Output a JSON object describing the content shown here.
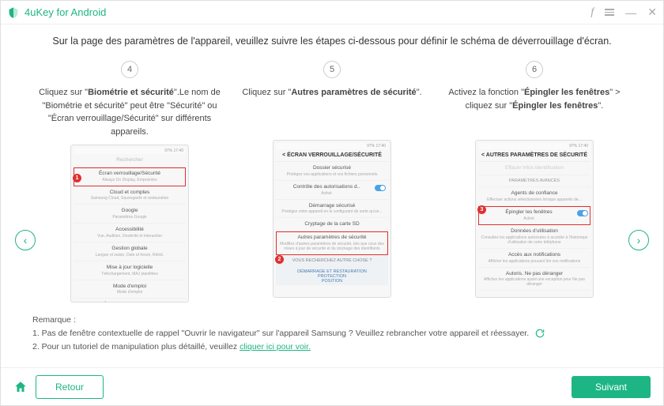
{
  "titlebar": {
    "appName": "4uKey for Android"
  },
  "instruction": "Sur la page des paramètres de l'appareil, veuillez suivre les étapes ci-dessous pour définir le schéma de déverrouillage d'écran.",
  "steps": [
    {
      "num": "4",
      "pre": "Cliquez sur \"",
      "bold": "Biométrie et sécurité",
      "post": "\".Le nom de \"Biométrie et sécurité\" peut être \"Sécurité\" ou \"Écran verrouillage/Sécurité\" sur différents appareils."
    },
    {
      "num": "5",
      "pre": "Cliquez sur \"",
      "bold": "Autres paramètres de sécurité",
      "post": "\"."
    },
    {
      "num": "6",
      "pre": "Activez la fonction \"",
      "bold": "Épingler les fenêtres",
      "mid": "\" > cliquez sur \"",
      "bold2": "Épingler les fenêtres",
      "post": "\"."
    }
  ],
  "phone1": {
    "search": "Rechercher",
    "hl": "Écran verrouillage/Sécurité",
    "hlSub": "Always On Display, Empreintes",
    "items": [
      {
        "t": "Cloud et comptes",
        "s": "Samsung Cloud, Sauvegarde et restauration"
      },
      {
        "t": "Google",
        "s": "Paramètres Google"
      },
      {
        "t": "Accessibilité",
        "s": "Vue, Audition, Dextérité et interaction"
      },
      {
        "t": "Gestion globale",
        "s": "Langue et saisie, Date et heure, Réinit."
      },
      {
        "t": "Mise à jour logicielle",
        "s": "Téléchargement, MAJ planifiées"
      },
      {
        "t": "Mode d'emploi",
        "s": "Mode d'emploi"
      },
      {
        "t": "À propos du téléphone",
        "s": ""
      }
    ]
  },
  "phone2": {
    "head": "ÉCRAN VERROUILLAGE/SÉCURITÉ",
    "items": [
      {
        "t": "Dossier sécurisé",
        "s": "Protégez vos applications et vos fichiers personnels"
      },
      {
        "t": "Contrôle des autorisations d..",
        "s": "Activé",
        "toggle": true
      },
      {
        "t": "Démarrage sécurisé",
        "s": "Protégez votre appareil en le configurant de sorte qu'un..."
      },
      {
        "t": "Cryptage de la carte SD",
        "s": ""
      }
    ],
    "hl": "Autres paramètres de sécurité",
    "hlSub": "Modifiez d'autres paramètres de sécurité, tels que ceux des mises à jour de sécurité et du stockage des identifiants",
    "footer": [
      "DÉMARRAGE ET RESTAURATION",
      "PROTECTION",
      "POSITION"
    ],
    "footerHead": "VOUS RECHERCHEZ AUTRE CHOSE ?"
  },
  "phone3": {
    "head": "AUTRES PARAMÈTRES DE SÉCURITÉ",
    "items": [
      {
        "t": "Effacer infos identification",
        "s": ""
      },
      {
        "t": "PARAMÈTRES AVANCÉS",
        "s": "",
        "section": true
      },
      {
        "t": "Agents de confiance",
        "s": "Effectuer actions sélectionnées lorsque appareils de..."
      }
    ],
    "hl": "Épingler les fenêtres",
    "hlSub": "Activé",
    "after": [
      {
        "t": "Données d'utilisation",
        "s": "Consultez les applications autorisées à accéder à l'historique d'utilisation de votre téléphone"
      },
      {
        "t": "Accès aux notifications",
        "s": "Afficher les applications pouvant lire vos notifications"
      },
      {
        "t": "Autoris. Ne pas déranger",
        "s": "Affichez les applications ayant une exception pour Ne pas déranger"
      }
    ]
  },
  "remarks": {
    "title": "Remarque :",
    "line1": "1. Pas de fenêtre contextuelle de rappel \"Ouvrir le navigateur\" sur l'appareil Samsung ? Veuillez rebrancher votre appareil et réessayer.",
    "line2pre": "2. Pour un tutoriel de manipulation plus détaillé, veuillez ",
    "line2link": "cliquer ici pour voir."
  },
  "footer": {
    "back": "Retour",
    "next": "Suivant"
  }
}
